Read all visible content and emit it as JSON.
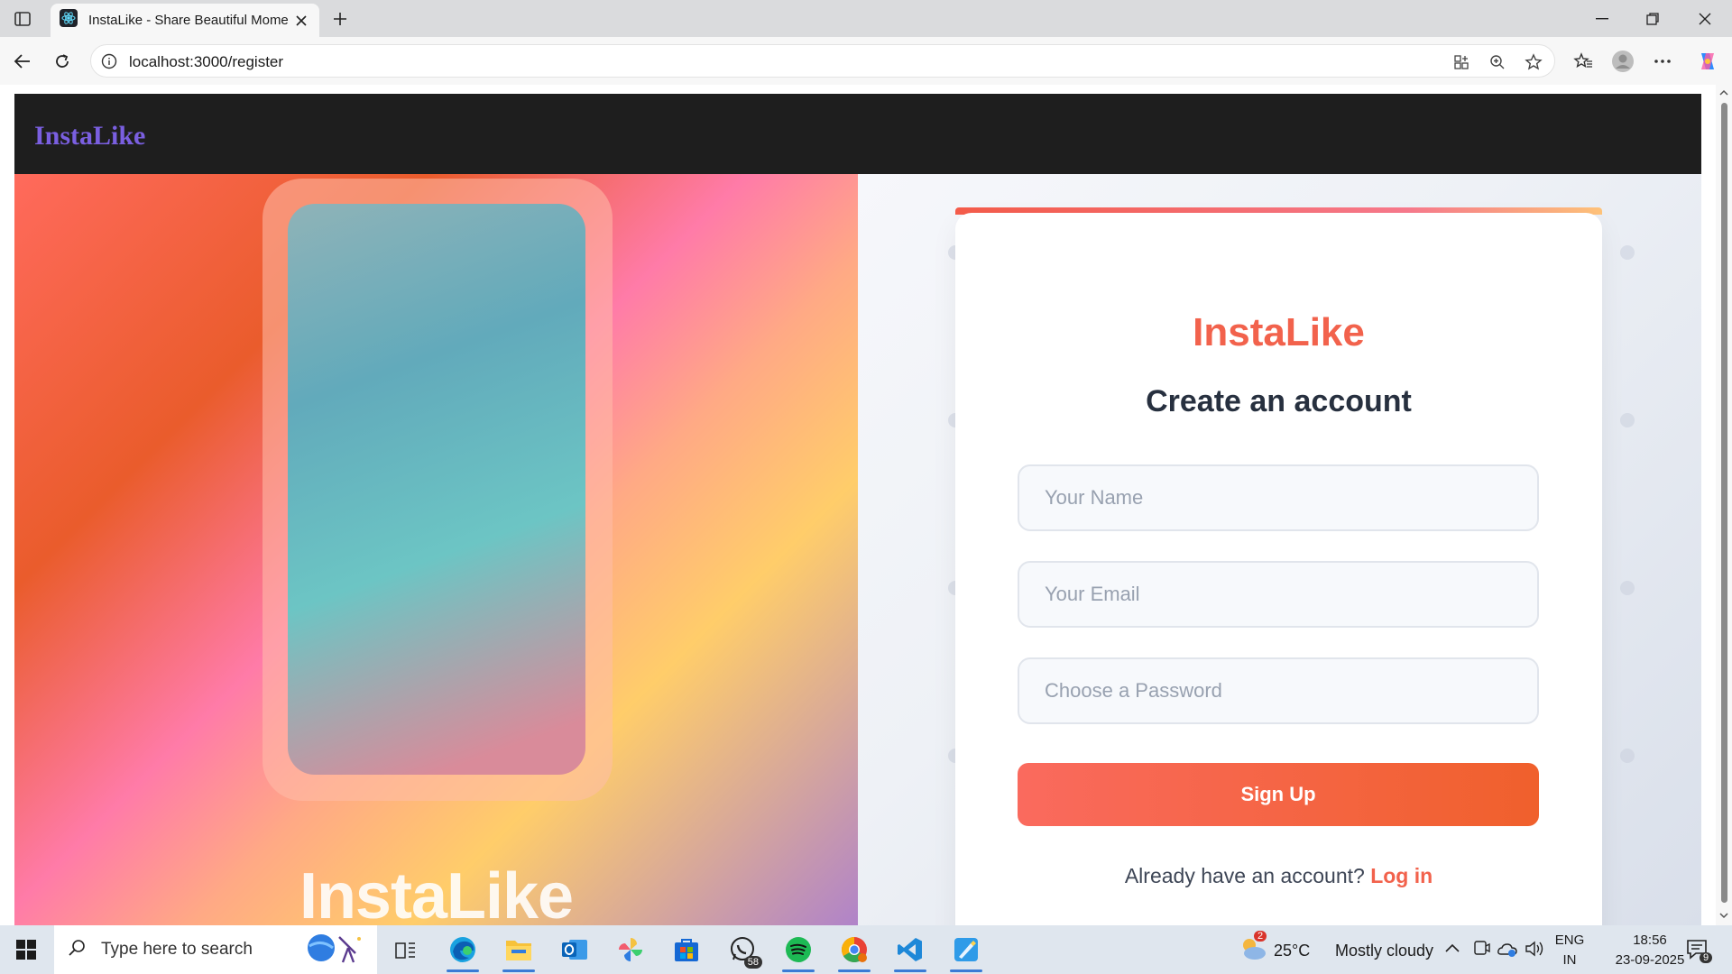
{
  "browser": {
    "tab": {
      "title": "InstaLike - Share Beautiful Moments"
    },
    "url": "localhost:3000/register"
  },
  "page": {
    "navbar": {
      "logo": "InstaLike"
    },
    "hero": {
      "brand": "InstaLike"
    },
    "form": {
      "brand": "InstaLike",
      "title": "Create an account",
      "name_placeholder": "Your Name",
      "email_placeholder": "Your Email",
      "password_placeholder": "Choose a Password",
      "submit_label": "Sign Up",
      "login_prompt": "Already have an account?",
      "login_link": "Log in"
    }
  },
  "taskbar": {
    "search_placeholder": "Type here to search",
    "whatsapp_badge": "58",
    "weather": {
      "temp": "25°C",
      "condition": "Mostly cloudy",
      "alert_count": "2"
    },
    "language": {
      "lang": "ENG",
      "region": "IN"
    },
    "clock": {
      "time": "18:56",
      "date": "23-09-2025"
    },
    "notification_count": "9"
  },
  "colors": {
    "brand": "#f2624c",
    "nav_logo": "#7a5fe0",
    "navbar_bg": "#1e1e1e"
  }
}
